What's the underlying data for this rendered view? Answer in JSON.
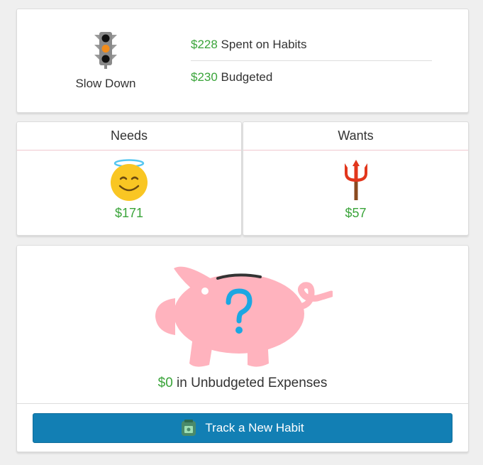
{
  "status": {
    "label": "Slow Down",
    "icon": "traffic-light-icon",
    "spent_amount": "$228",
    "spent_label": " Spent on Habits",
    "budget_amount": "$230",
    "budget_label": " Budgeted"
  },
  "categories": [
    {
      "name": "Needs",
      "icon": "angel-face-icon",
      "amount": "$171"
    },
    {
      "name": "Wants",
      "icon": "devil-trident-icon",
      "amount": "$57"
    }
  ],
  "unbudgeted": {
    "icon": "piggy-bank-question-icon",
    "amount": "$0",
    "label": " in Unbudgeted Expenses"
  },
  "actions": {
    "track_label": "Track a New Habit",
    "track_icon": "money-jar-icon"
  },
  "colors": {
    "money_green": "#3aa43a",
    "button_blue": "#127fb4",
    "pig_pink": "#ffb3be",
    "question_blue": "#1ba7e2"
  }
}
